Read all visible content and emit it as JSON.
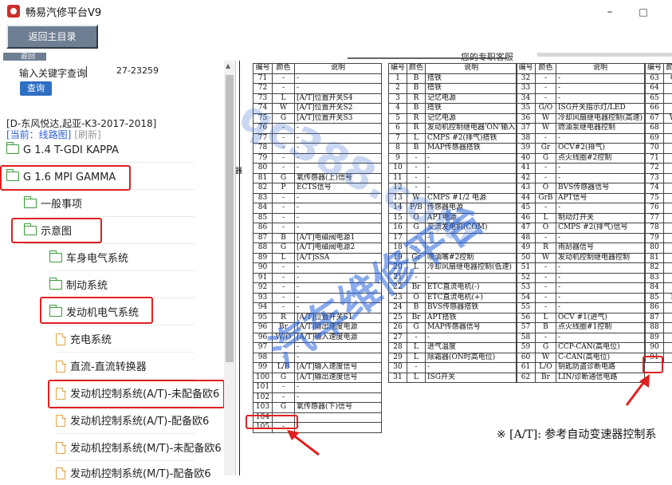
{
  "window": {
    "title": "畅易汽修平台V9",
    "minimize": "–",
    "maximize": "□"
  },
  "toolbar": {
    "back_label": "返回主目录",
    "tab_label": "返回"
  },
  "search": {
    "label": "输入关键字查询",
    "button": "查询",
    "date": "27-23259"
  },
  "vehicle": "[D-东风悦达,起亚-K3-2017-2018]",
  "current": {
    "label": "[当前：线路图]",
    "refresh": "[刷新]"
  },
  "tree": [
    {
      "label": "G 1.4 T-GDI KAPPA",
      "icon": "folder-icon"
    },
    {
      "label": "G 1.6 MPI GAMMA",
      "icon": "folder-open-icon"
    },
    {
      "label": "一般事项",
      "icon": "folder-icon"
    },
    {
      "label": "示意图",
      "icon": "folder-open-icon"
    },
    {
      "label": "车身电气系统",
      "icon": "folder-icon"
    },
    {
      "label": "制动系统",
      "icon": "folder-icon"
    },
    {
      "label": "发动机电气系统",
      "icon": "folder-open-icon"
    },
    {
      "label": "充电系统",
      "icon": "document-icon"
    },
    {
      "label": "直流-直流转换器",
      "icon": "document-icon"
    },
    {
      "label": "发动机控制系统(A/T)-未配备欧6",
      "icon": "document-icon"
    },
    {
      "label": "发动机控制系统(A/T)-配备欧6",
      "icon": "document-icon"
    },
    {
      "label": "发动机控制系统(M/T)-未配备欧6",
      "icon": "document-icon"
    },
    {
      "label": "发动机控制系统(M/T)-配备欧6",
      "icon": "document-icon"
    }
  ],
  "document": {
    "service_text": "您的专职客服",
    "headers": {
      "num": "编号",
      "color": "颜色",
      "desc": "说明"
    },
    "left_col_label": "器",
    "table1": [
      [
        "71",
        "-",
        "-"
      ],
      [
        "72",
        "-",
        "-"
      ],
      [
        "73",
        "L",
        "[A/T]位置开关S4"
      ],
      [
        "74",
        "W",
        "[A/T]位置开关S2"
      ],
      [
        "75",
        "G",
        "[A/T]位置开关S3"
      ],
      [
        "76",
        "-",
        "-"
      ],
      [
        "77",
        "-",
        "-"
      ],
      [
        "78",
        "-",
        "-"
      ],
      [
        "79",
        "-",
        "-"
      ],
      [
        "80",
        "-",
        "-"
      ],
      [
        "81",
        "G",
        "氧传感器(上)信号"
      ],
      [
        "82",
        "P",
        "ECTS信号"
      ],
      [
        "83",
        "-",
        "-"
      ],
      [
        "84",
        "-",
        "-"
      ],
      [
        "85",
        "-",
        "-"
      ],
      [
        "86",
        "-",
        "-"
      ],
      [
        "87",
        "B",
        "[A/T]电磁阀电源1"
      ],
      [
        "88",
        "G",
        "[A/T]电磁阀电源2"
      ],
      [
        "89",
        "L",
        "[A/T]SSA"
      ],
      [
        "90",
        "-",
        "-"
      ],
      [
        "91",
        "-",
        "-"
      ],
      [
        "92",
        "-",
        "-"
      ],
      [
        "93",
        "-",
        "-"
      ],
      [
        "94",
        "-",
        "-"
      ],
      [
        "95",
        "R",
        "[A/T]位置开关S1"
      ],
      [
        "96",
        "Br",
        "[A/T]输出速度电源"
      ],
      [
        "96",
        "W/O",
        "[A/T]输入速度电源"
      ],
      [
        "97",
        "-",
        "-"
      ],
      [
        "98",
        "-",
        "-"
      ],
      [
        "99",
        "L/B",
        "[A/T]输入速度信号"
      ],
      [
        "100",
        "G",
        "[A/T]输出速度信号"
      ],
      [
        "101",
        "-",
        "-"
      ],
      [
        "102",
        "-",
        "-"
      ],
      [
        "103",
        "G",
        "氧传感器(下)信号"
      ],
      [
        "104",
        "",
        ""
      ],
      [
        "105",
        "-",
        "-"
      ]
    ],
    "table2": [
      [
        "1",
        "B",
        "搭铁"
      ],
      [
        "2",
        "B",
        "搭铁"
      ],
      [
        "3",
        "R",
        "记忆电源"
      ],
      [
        "4",
        "B",
        "搭铁"
      ],
      [
        "5",
        "R",
        "记忆电源"
      ],
      [
        "6",
        "R",
        "发动机控制继电器'ON'输入"
      ],
      [
        "7",
        "L",
        "CMPS #2(排气)搭铁"
      ],
      [
        "8",
        "B",
        "MAP传感器搭铁"
      ],
      [
        "9",
        "-",
        "-"
      ],
      [
        "10",
        "-",
        "-"
      ],
      [
        "11",
        "-",
        "-"
      ],
      [
        "12",
        "-",
        "-"
      ],
      [
        "13",
        "W",
        "CMPS #1/2 电源"
      ],
      [
        "14",
        "P/B",
        "传感器电源"
      ],
      [
        "15",
        "O",
        "APT电源"
      ],
      [
        "16",
        "G",
        "交流发电机(COM)"
      ],
      [
        "17",
        "-",
        "-"
      ],
      [
        "18",
        "-",
        "-"
      ],
      [
        "19",
        "Gr",
        "喷油嘴#2控制"
      ],
      [
        "20",
        "L",
        "冷却风扇继电器控制(低速)"
      ],
      [
        "21",
        "-",
        "-"
      ],
      [
        "22",
        "Br",
        "ETC直流电机(-)"
      ],
      [
        "23",
        "O",
        "ETC直流电机(+)"
      ],
      [
        "24",
        "B",
        "BVS传感器搭铁"
      ],
      [
        "25",
        "Br",
        "APT搭铁"
      ],
      [
        "26",
        "G",
        "MAP传感器信号"
      ],
      [
        "27",
        "-",
        "-"
      ],
      [
        "28",
        "L",
        "进气温度"
      ],
      [
        "29",
        "L",
        "除霜器(ON时高电位)"
      ],
      [
        "30",
        "-",
        "-"
      ],
      [
        "31",
        "L",
        "ISG开关"
      ]
    ],
    "table3": [
      [
        "32",
        "-",
        "-"
      ],
      [
        "33",
        "-",
        "-"
      ],
      [
        "34",
        "-",
        "-"
      ],
      [
        "35",
        "G/O",
        "ISG开关指示灯/LED"
      ],
      [
        "36",
        "W",
        "冷却风扇继电器控制(高速)"
      ],
      [
        "37",
        "W",
        "燃油泵继电器控制"
      ],
      [
        "38",
        "-",
        "-"
      ],
      [
        "39",
        "Gr",
        "OCV#2(排气)"
      ],
      [
        "40",
        "G",
        "点火线圈#2控制"
      ],
      [
        "41",
        "-",
        "-"
      ],
      [
        "42",
        "-",
        "-"
      ],
      [
        "43",
        "O",
        "BVS传感器信号"
      ],
      [
        "44",
        "GrB",
        "APT信号"
      ],
      [
        "45",
        "-",
        "-"
      ],
      [
        "46",
        "L",
        "制动灯开关"
      ],
      [
        "47",
        "O",
        "CMPS #2(排气)信号"
      ],
      [
        "48",
        "-",
        "-"
      ],
      [
        "49",
        "R",
        "雨刮器信号"
      ],
      [
        "50",
        "W",
        "发动机控制继电器控制"
      ],
      [
        "51",
        "-",
        "-"
      ],
      [
        "52",
        "-",
        "-"
      ],
      [
        "53",
        "-",
        "-"
      ],
      [
        "54",
        "-",
        "-"
      ],
      [
        "55",
        "-",
        "-"
      ],
      [
        "56",
        "L",
        "OCV #1(进气)"
      ],
      [
        "57",
        "B",
        "点火线圈#1控制"
      ],
      [
        "58",
        "-",
        "-"
      ],
      [
        "59",
        "G",
        "CCP-CAN(高电位)"
      ],
      [
        "60",
        "W",
        "C-CAN(高电位)"
      ],
      [
        "61",
        "L/O",
        "钥匙防盗诊断电路"
      ],
      [
        "62",
        "Br",
        "LIN/诊断通信电路"
      ]
    ],
    "table4": [
      "63",
      "64",
      "65",
      "66",
      "67",
      "68",
      "69",
      "70",
      "71",
      "72",
      "73",
      "74",
      "75",
      "76",
      "77",
      "78",
      "79",
      "80",
      "81",
      "82",
      "83",
      "84",
      "85",
      "86",
      "87",
      "88",
      "89",
      "90",
      "91"
    ],
    "table4_colors": [
      "G",
      "",
      "",
      "",
      "W",
      "",
      "",
      "",
      "",
      "",
      "",
      "",
      "",
      "",
      "",
      "",
      "",
      "",
      "",
      "",
      "",
      "",
      "L",
      "",
      "",
      "",
      "",
      "",
      ""
    ],
    "note": "※ [A/T]: 参考自动变速器控制系"
  },
  "watermark": {
    "domain": "qc388.com",
    "brand": "汽车维修平台"
  },
  "colors": {
    "accent_red": "#e02020",
    "button_gray": "#6f7f93",
    "link_blue": "#2b5fd9",
    "folder_green": "#3c9a3a",
    "doc_orange": "#e0a348"
  }
}
